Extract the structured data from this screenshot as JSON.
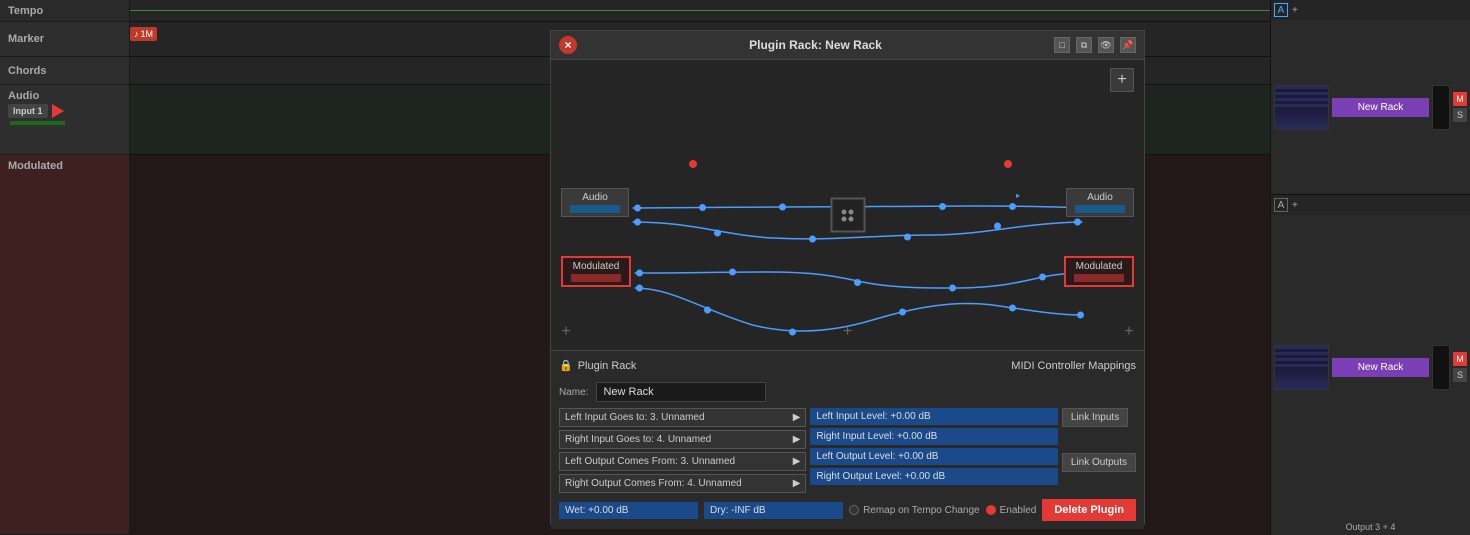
{
  "app": {
    "title": "Plugin Rack: New Rack"
  },
  "tracks": {
    "tempo": {
      "label": "Tempo"
    },
    "marker": {
      "label": "Marker"
    },
    "chords": {
      "label": "Chords"
    },
    "audio": {
      "label": "Audio",
      "input": "Input 1"
    },
    "modulated": {
      "label": "Modulated"
    }
  },
  "dialog": {
    "title": "Plugin Rack: New Rack",
    "close_btn": "×",
    "add_btn": "+",
    "panel": {
      "title": "Plugin Rack",
      "midi_label": "MIDI Controller Mappings",
      "name_label": "Name:",
      "name_value": "New Rack",
      "rows": [
        {
          "left_goes_label": "Left Input Goes to: 3. Unnamed",
          "level_label": "Left Input Level: +0.00 dB"
        },
        {
          "left_goes_label": "Right Input Goes to: 4. Unnamed",
          "level_label": "Right Input Level: +0.00 dB"
        },
        {
          "left_goes_label": "Left Output Comes From: 3. Unnamed",
          "level_label": "Left Output Level: +0.00 dB"
        },
        {
          "left_goes_label": "Right Output Comes From: 4. Unnamed",
          "level_label": "Right Output Level: +0.00 dB"
        }
      ],
      "link_inputs": "Link Inputs",
      "link_outputs": "Link Outputs",
      "wet_label": "Wet: +0.00 dB",
      "dry_label": "Dry: -INF dB",
      "remap_label": "Remap on Tempo Change",
      "enabled_label": "Enabled",
      "delete_label": "Delete Plugin"
    }
  },
  "right_panel": {
    "rack1": {
      "name": "New Rack",
      "m_label": "M",
      "s_label": "S"
    },
    "rack2": {
      "name": "New Rack",
      "output_label": "Output 3 + 4",
      "m_label": "M",
      "s_label": "S"
    }
  },
  "nodes": {
    "audio_left": "Audio",
    "audio_right": "Audio",
    "modulated_left": "Modulated",
    "modulated_right": "Modulated"
  }
}
